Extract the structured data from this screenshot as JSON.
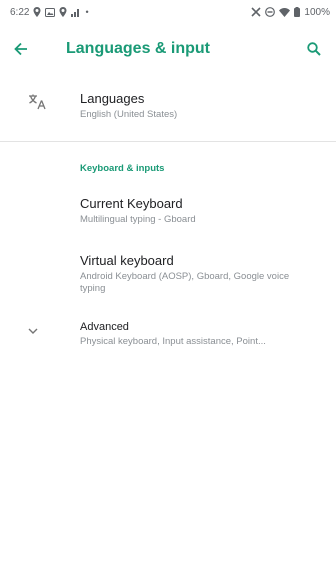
{
  "status": {
    "time": "6:22",
    "battery": "100%"
  },
  "appbar": {
    "title": "Languages & input"
  },
  "items": {
    "languages": {
      "label": "Languages",
      "sub": "English (United States)"
    },
    "section_title": "Keyboard & inputs",
    "current_keyboard": {
      "label": "Current Keyboard",
      "sub": "Multilingual typing - Gboard"
    },
    "virtual_keyboard": {
      "label": "Virtual keyboard",
      "sub": "Android Keyboard (AOSP), Gboard, Google voice typing"
    },
    "advanced": {
      "label": "Advanced",
      "sub": "Physical keyboard, Input assistance, Point..."
    }
  },
  "colors": {
    "accent": "#1a9a76"
  },
  "icons": [
    "location-icon",
    "image-icon",
    "location-icon",
    "signal-icon",
    "mute-icon",
    "do-not-disturb-icon",
    "wifi-icon",
    "battery-icon",
    "back-arrow-icon",
    "search-icon",
    "translate-icon",
    "chevron-down-icon"
  ]
}
